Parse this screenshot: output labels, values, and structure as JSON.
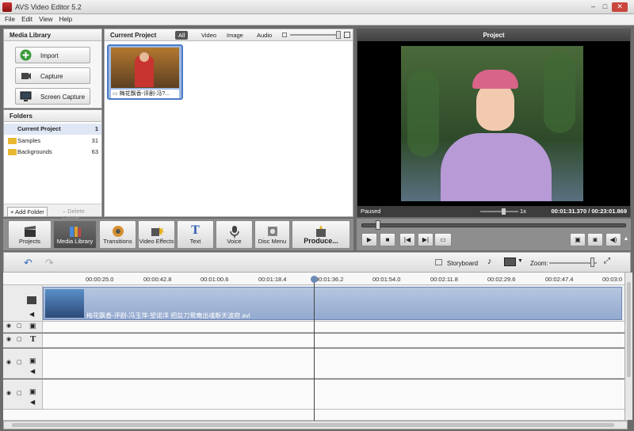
{
  "window": {
    "title": "AVS Video Editor 5.2"
  },
  "menu": [
    "File",
    "Edit",
    "View",
    "Help"
  ],
  "media_library": {
    "title": "Media Library",
    "buttons": [
      "Import",
      "Capture",
      "Screen Capture"
    ]
  },
  "folders": {
    "title": "Folders",
    "items": [
      {
        "name": "Current Project",
        "count": "1"
      },
      {
        "name": "Samples",
        "count": "31"
      },
      {
        "name": "Backgrounds",
        "count": "63"
      }
    ],
    "add_label": "+ Add Folder",
    "delete_label": "– Delete Folder"
  },
  "current_project": {
    "title": "Current Project",
    "tabs": [
      "All",
      "Video",
      "Image",
      "Audio"
    ],
    "active_tab": "All",
    "clip_label": "梅花飘香-评剧-冯?..."
  },
  "project_panel": {
    "title": "Project",
    "status": "Paused",
    "speed": "1x",
    "time": "00:01:31.370 / 00:23:01.869"
  },
  "toolbar": [
    "Projects",
    "Media Library",
    "Transitions",
    "Video Effects",
    "Text",
    "Voice",
    "Disc Menu",
    "Produce..."
  ],
  "timeline": {
    "storyboard_label": "Storyboard",
    "zoom_label": "Zoom:",
    "ruler": [
      "00:00:25.0",
      "00:00:42.8",
      "00:01:00.6",
      "00:01:18.4",
      "00:01:36.2",
      "00:01:54.0",
      "00:02:11.8",
      "00:02:29.6",
      "00:02:47.4",
      "00:03:0"
    ],
    "clip_filename": "梅花飘香-评剧-冯玉萍-望诺洋 把盐刀鸳鸯出魂断天波府.avi"
  }
}
